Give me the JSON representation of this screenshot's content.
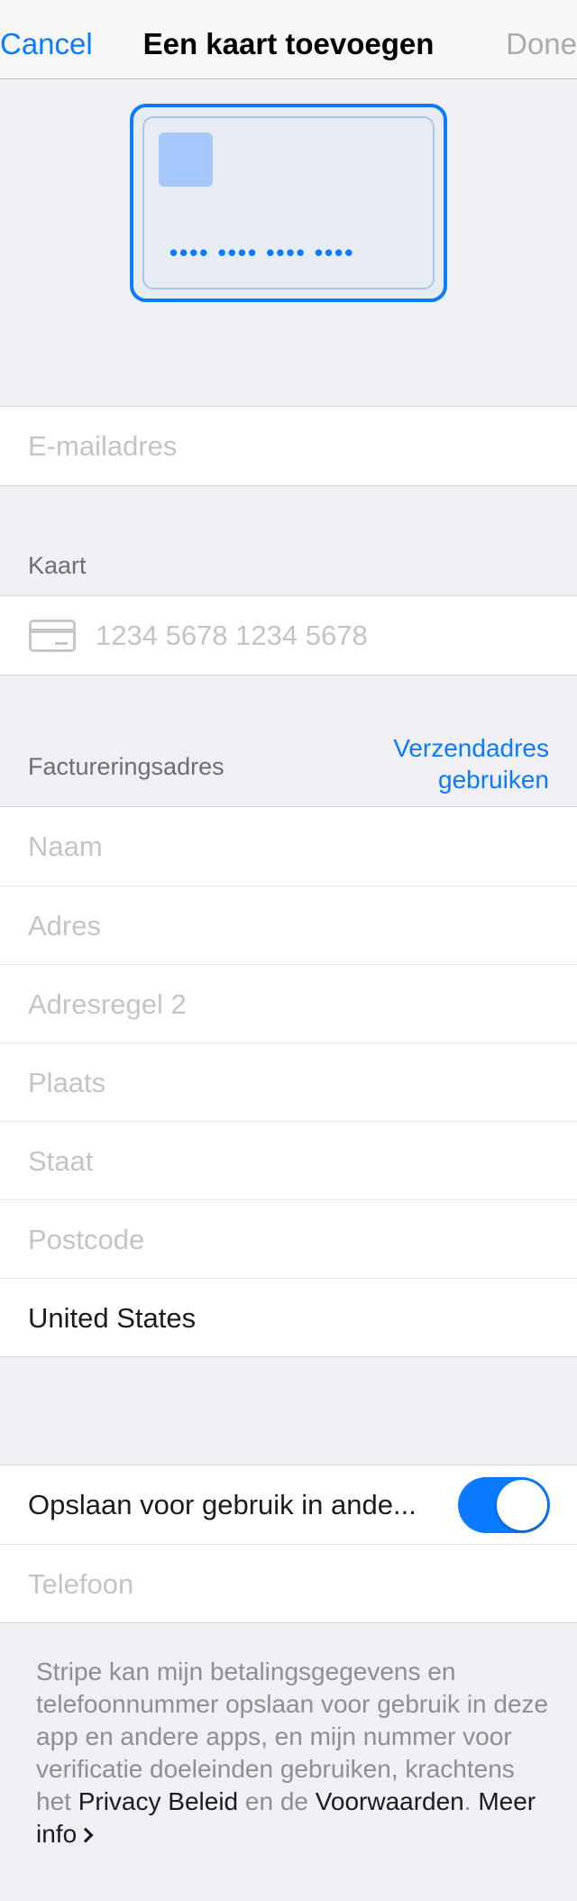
{
  "nav": {
    "cancel_label": "Cancel",
    "title": "Een kaart toevoegen",
    "done_label": "Done"
  },
  "card_preview": {
    "number_mask": "•••• •••• •••• ••••"
  },
  "email": {
    "placeholder": "E-mailadres"
  },
  "card": {
    "section_label": "Kaart",
    "number_placeholder": "1234 5678 1234 5678",
    "icon": "credit-card-icon"
  },
  "billing": {
    "section_label": "Factureringsadres",
    "use_shipping_line1": "Verzendadres",
    "use_shipping_line2": "gebruiken",
    "fields": {
      "name": "Naam",
      "address": "Adres",
      "address2": "Adresregel 2",
      "city": "Plaats",
      "state": "Staat",
      "postal": "Postcode"
    },
    "country": "United States"
  },
  "save": {
    "label": "Opslaan voor gebruik in ande...",
    "toggle_on": true,
    "phone_placeholder": "Telefoon"
  },
  "footer": {
    "text_part1": "Stripe kan mijn betalingsgegevens en telefoonnummer opslaan voor gebruik in deze app en andere apps, en mijn nummer voor verificatie doeleinden gebruiken, krachtens het ",
    "privacy_link": "Privacy Beleid",
    "text_part2": " en de ",
    "terms_link": "Voorwaarden",
    "text_part3": ". ",
    "more_info_link": "Meer info"
  },
  "colors": {
    "accent": "#0a7aff",
    "background": "#efeff4",
    "placeholder": "#c4c4c8"
  }
}
